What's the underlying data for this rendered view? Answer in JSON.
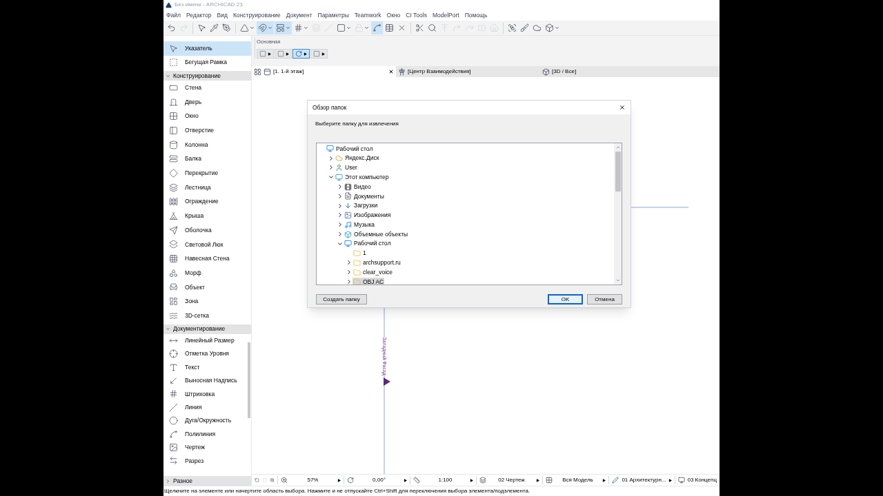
{
  "window": {
    "title": "Без имени - ARCHICAD 23"
  },
  "menu": [
    "Файл",
    "Редактор",
    "Вид",
    "Конструирование",
    "Документ",
    "Параметры",
    "Teamwork",
    "Окно",
    "CI Tools",
    "ModelPort",
    "Помощь"
  ],
  "toolbar": [
    {
      "selected": false,
      "disabled": false,
      "menu": false
    },
    {
      "selected": false,
      "disabled": true,
      "menu": false
    },
    {
      "selected": false,
      "disabled": false,
      "menu": false
    },
    {
      "selected": false,
      "disabled": false,
      "menu": false
    },
    {
      "selected": false,
      "disabled": false,
      "menu": false
    },
    {
      "selected": false,
      "disabled": false,
      "menu": true
    },
    {
      "selected": true,
      "disabled": false,
      "menu": true
    },
    {
      "selected": true,
      "disabled": false,
      "menu": true
    },
    {
      "selected": false,
      "disabled": false,
      "menu": true
    },
    {
      "selected": false,
      "disabled": true,
      "menu": false
    },
    {
      "selected": false,
      "disabled": true,
      "menu": false
    },
    {
      "selected": false,
      "disabled": false,
      "menu": true
    },
    {
      "selected": false,
      "disabled": true,
      "menu": true
    },
    {
      "selected": true,
      "disabled": false,
      "menu": false
    },
    {
      "selected": false,
      "disabled": false,
      "menu": false
    },
    {
      "selected": false,
      "disabled": false,
      "menu": false
    },
    {
      "selected": false,
      "disabled": false,
      "menu": false
    },
    {
      "selected": false,
      "disabled": false,
      "menu": false
    },
    {
      "selected": false,
      "disabled": true,
      "menu": false
    },
    {
      "selected": false,
      "disabled": true,
      "menu": false
    },
    {
      "selected": false,
      "disabled": true,
      "menu": false
    },
    {
      "selected": false,
      "disabled": true,
      "menu": false
    },
    {
      "selected": false,
      "disabled": true,
      "menu": false
    },
    {
      "selected": false,
      "disabled": false,
      "menu": false
    },
    {
      "selected": false,
      "disabled": false,
      "menu": false
    },
    {
      "selected": false,
      "disabled": false,
      "menu": false
    },
    {
      "selected": false,
      "disabled": false,
      "menu": true
    }
  ],
  "info_box": {
    "title": "Основная",
    "buttons": [
      {
        "selected": false
      },
      {
        "selected": false
      },
      {
        "selected": true
      },
      {
        "selected": false
      }
    ]
  },
  "toolbox": {
    "top_items": [
      {
        "label": "Указатель",
        "selected": true
      },
      {
        "label": "Бегущая Рамка",
        "selected": false
      }
    ],
    "sections": [
      {
        "title": "Конструирование",
        "expanded": true,
        "items": [
          {
            "label": "Стена",
            "selected": false
          },
          {
            "label": "Дверь",
            "selected": false
          },
          {
            "label": "Окно",
            "selected": false
          },
          {
            "label": "Отверстие",
            "selected": false
          },
          {
            "label": "Колонна",
            "selected": false
          },
          {
            "label": "Балка",
            "selected": false
          },
          {
            "label": "Перекрытие",
            "selected": false
          },
          {
            "label": "Лестница",
            "selected": false
          },
          {
            "label": "Ограждение",
            "selected": false
          },
          {
            "label": "Крыша",
            "selected": false
          },
          {
            "label": "Оболочка",
            "selected": false
          },
          {
            "label": "Световой Люк",
            "selected": false
          },
          {
            "label": "Навесная Стена",
            "selected": false
          },
          {
            "label": "Морф",
            "selected": false
          },
          {
            "label": "Объект",
            "selected": false
          },
          {
            "label": "Зона",
            "selected": false
          },
          {
            "label": "3D-сетка",
            "selected": false
          }
        ]
      },
      {
        "title": "Документирование",
        "expanded": true,
        "items": [
          {
            "label": "Линейный Размер",
            "selected": false
          },
          {
            "label": "Отметка Уровня",
            "selected": false
          },
          {
            "label": "Текст",
            "selected": false
          },
          {
            "label": "Выносная Надпись",
            "selected": false
          },
          {
            "label": "Штриховка",
            "selected": false
          },
          {
            "label": "Линия",
            "selected": false
          },
          {
            "label": "Дуга/Окружность",
            "selected": false
          },
          {
            "label": "Полилиния",
            "selected": false
          },
          {
            "label": "Чертеж",
            "selected": false
          },
          {
            "label": "Разрез",
            "selected": false
          }
        ]
      },
      {
        "title": "Разное",
        "expanded": false
      }
    ]
  },
  "tabs": [
    {
      "label": "[1. 1-й этаж]",
      "selected": true,
      "kind": "plan"
    },
    {
      "label": "[Центр Взаимодействия]",
      "selected": false,
      "kind": "center"
    },
    {
      "label": "[3D / Все]",
      "selected": false,
      "kind": "model"
    }
  ],
  "canvas": {
    "marker_label": "Западный Фасад"
  },
  "dialog": {
    "title": "Обзор папок",
    "prompt": "Выберите папку для извлечения",
    "tree": [
      {
        "label": "Рабочий стол",
        "kind": "desktop",
        "selected": false,
        "children": [
          {
            "label": "Яндекс.Диск",
            "kind": "cloud",
            "expanded": false,
            "selected": false
          },
          {
            "label": "User",
            "kind": "user",
            "expanded": false,
            "selected": false
          },
          {
            "label": "Этот компьютер",
            "kind": "computer",
            "expanded": true,
            "selected": false,
            "children": [
              {
                "label": "Видео",
                "kind": "video",
                "expanded": false,
                "selected": false
              },
              {
                "label": "Документы",
                "kind": "docs",
                "expanded": false,
                "selected": false
              },
              {
                "label": "Загрузки",
                "kind": "download",
                "expanded": false,
                "selected": false
              },
              {
                "label": "Изображения",
                "kind": "images",
                "expanded": false,
                "selected": false
              },
              {
                "label": "Музыка",
                "kind": "music",
                "expanded": false,
                "selected": false
              },
              {
                "label": "Объемные объекты",
                "kind": "objects",
                "expanded": false,
                "selected": false
              },
              {
                "label": "Рабочий стол",
                "kind": "desktop",
                "expanded": true,
                "selected": false,
                "children": [
                  {
                    "label": "1",
                    "kind": "folder",
                    "selected": false
                  },
                  {
                    "label": "archsupport.ru",
                    "kind": "folder",
                    "expanded": false,
                    "selected": false
                  },
                  {
                    "label": "clear_voice",
                    "kind": "folder",
                    "expanded": false,
                    "selected": false
                  },
                  {
                    "label": "OBJ AC",
                    "kind": "folder",
                    "expanded": false,
                    "selected": true
                  }
                ]
              }
            ]
          }
        ]
      }
    ],
    "buttons": [
      {
        "label": "Создать папку",
        "selected": false
      },
      {
        "label": "OK",
        "selected": true
      },
      {
        "label": "Отмена",
        "selected": false
      }
    ]
  },
  "nav_bar": [
    "57%",
    "0,00°",
    "1:100",
    "02 Чертеж",
    "Вся Модель",
    "01 Архитектурн...",
    "03 Концепц"
  ],
  "status_bar": "Щелкните на элементе или начертите область выбора. Нажмите и не отпускайте Ctrl+Shift для переключения выбора элемента/подэлемента."
}
